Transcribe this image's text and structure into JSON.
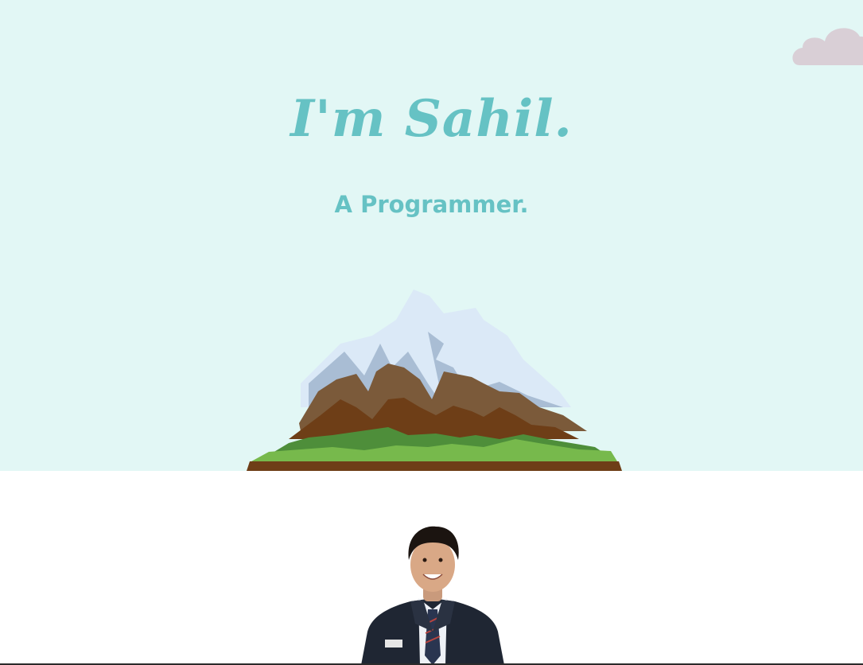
{
  "hero": {
    "title": "I'm Sahil.",
    "subtitle": "A Programmer.",
    "background_color": "#e2f7f5",
    "accent_color": "#66c2c4"
  },
  "decorations": {
    "cloud": "cloud-icon",
    "mountain": "mountain-illustration"
  },
  "about": {
    "portrait": "profile-photo"
  }
}
